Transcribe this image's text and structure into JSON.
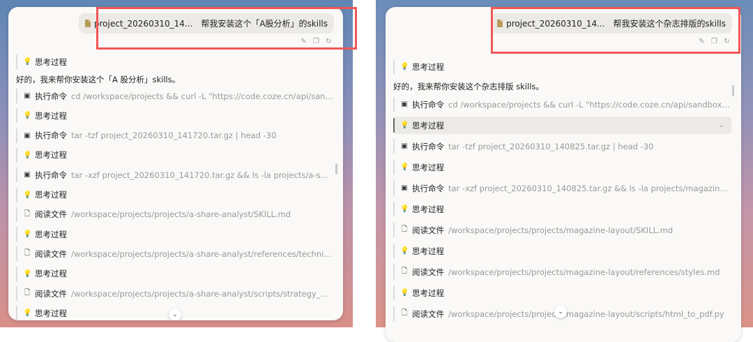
{
  "left": {
    "message": {
      "file": "project_20260310_14...",
      "text": "帮我安装这个「A股分析」的skills"
    },
    "reply": "好的，我来帮你安装这个「A 股分析」skills。",
    "steps": [
      {
        "icon": "bulb",
        "label": "思考过程",
        "detail": ""
      },
      {
        "icon": "terminal",
        "label": "执行命令",
        "detail": "cd /workspace/projects && curl -L \"https://code.coze.cn/api/sandbox/coze..."
      },
      {
        "icon": "bulb",
        "label": "思考过程",
        "detail": ""
      },
      {
        "icon": "terminal",
        "label": "执行命令",
        "detail": "tar -tzf project_20260310_141720.tar.gz | head -30"
      },
      {
        "icon": "bulb",
        "label": "思考过程",
        "detail": ""
      },
      {
        "icon": "terminal",
        "label": "执行命令",
        "detail": "tar -xzf project_20260310_141720.tar.gz && ls -la projects/a-share-analyst/"
      },
      {
        "icon": "bulb",
        "label": "思考过程",
        "detail": ""
      },
      {
        "icon": "doc",
        "label": "阅读文件",
        "detail": "/workspace/projects/projects/a-share-analyst/SKILL.md"
      },
      {
        "icon": "bulb",
        "label": "思考过程",
        "detail": ""
      },
      {
        "icon": "doc",
        "label": "阅读文件",
        "detail": "/workspace/projects/projects/a-share-analyst/references/technical_indicat..."
      },
      {
        "icon": "bulb",
        "label": "思考过程",
        "detail": ""
      },
      {
        "icon": "doc",
        "label": "阅读文件",
        "detail": "/workspace/projects/projects/a-share-analyst/scripts/strategy_multi_facto..."
      },
      {
        "icon": "bulb",
        "label": "思考过程",
        "detail": ""
      }
    ]
  },
  "right": {
    "message": {
      "file": "project_20260310_14...",
      "text": "帮我安装这个杂志排版的skills"
    },
    "reply": "好的，我来帮你安装这个杂志排版 skills。",
    "steps": [
      {
        "icon": "bulb",
        "label": "思考过程",
        "detail": ""
      },
      {
        "icon": "terminal",
        "label": "执行命令",
        "detail": "cd /workspace/projects && curl -L \"https://code.coze.cn/api/sandbox/coze..."
      },
      {
        "icon": "bulb",
        "label": "思考过程",
        "detail": "",
        "active": true
      },
      {
        "icon": "terminal",
        "label": "执行命令",
        "detail": "tar -tzf project_20260310_140825.tar.gz | head -30"
      },
      {
        "icon": "bulb",
        "label": "思考过程",
        "detail": ""
      },
      {
        "icon": "terminal",
        "label": "执行命令",
        "detail": "tar -xzf project_20260310_140825.tar.gz && ls -la projects/magazine-layo..."
      },
      {
        "icon": "bulb",
        "label": "思考过程",
        "detail": ""
      },
      {
        "icon": "doc",
        "label": "阅读文件",
        "detail": "/workspace/projects/projects/magazine-layout/SKILL.md"
      },
      {
        "icon": "bulb",
        "label": "思考过程",
        "detail": ""
      },
      {
        "icon": "doc",
        "label": "阅读文件",
        "detail": "/workspace/projects/projects/magazine-layout/references/styles.md"
      },
      {
        "icon": "bulb",
        "label": "思考过程",
        "detail": ""
      },
      {
        "icon": "doc",
        "label": "阅读文件",
        "detail": "/workspace/projects/projects/magazine-layout/scripts/html_to_pdf.py"
      }
    ]
  },
  "icons": {
    "bulb": "💡",
    "terminal": "▣",
    "doc": "🗋",
    "edit": "✎",
    "copy": "❐",
    "retry": "↻",
    "down": "⌄"
  }
}
